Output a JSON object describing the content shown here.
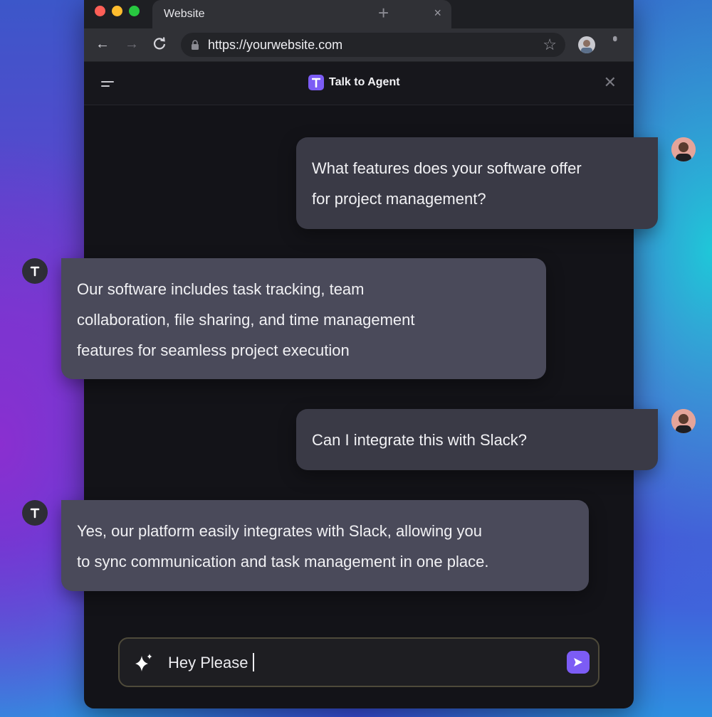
{
  "browser": {
    "tab_title": "Website",
    "tab_close": "×",
    "new_tab": "+",
    "url": "https://yourwebsite.com",
    "bookmark_star": "☆"
  },
  "chat": {
    "title": "Talk to Agent",
    "close": "✕",
    "messages": [
      {
        "role": "user",
        "lines": [
          "What features does your software offer",
          "for project management?"
        ]
      },
      {
        "role": "agent",
        "lines": [
          "Our software includes task tracking, team",
          "collaboration, file sharing, and time management",
          "features for seamless project execution"
        ]
      },
      {
        "role": "user",
        "lines": [
          "Can I integrate this with Slack?"
        ]
      },
      {
        "role": "agent",
        "lines": [
          "Yes, our platform easily integrates with Slack, allowing you",
          "to sync communication and task management in one place."
        ]
      }
    ],
    "input_value": "Hey Please"
  },
  "colors": {
    "accent": "#7c5cf5",
    "user_bubble": "#3a3a46",
    "agent_bubble": "#4a4a5a"
  }
}
